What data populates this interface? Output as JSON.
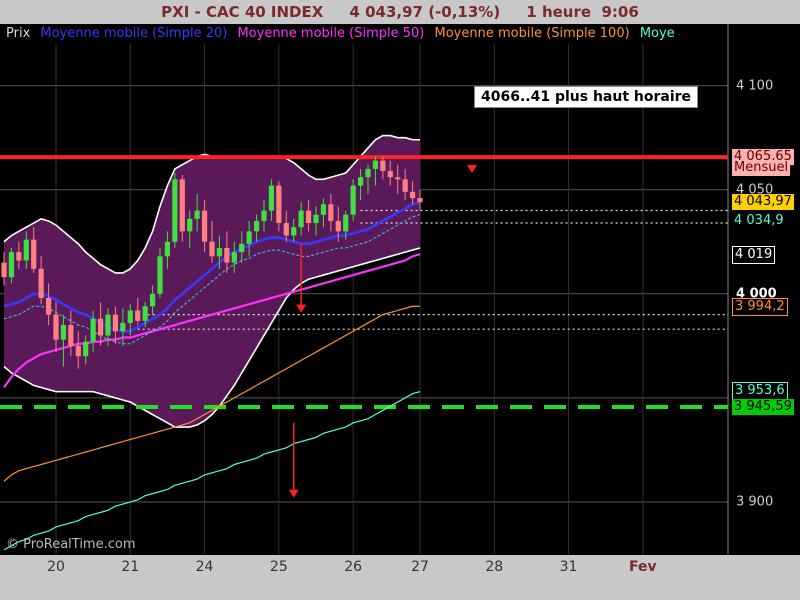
{
  "title": "PXI - CAC 40 INDEX     4 043,97 (-0,13%)     1 heure  9:06",
  "legend": [
    {
      "label": "Prix",
      "color": "#d8d8d8"
    },
    {
      "label": "Moyenne mobile (Simple 20)",
      "color": "#3838ff"
    },
    {
      "label": "Moyenne mobile (Simple 50)",
      "color": "#ff30ff"
    },
    {
      "label": "Moyenne mobile (Simple 100)",
      "color": "#ff9030"
    },
    {
      "label": "Moye",
      "color": "#50ffd8"
    }
  ],
  "annotation": "4066..41 plus haut  horaire",
  "copyright": "© ProRealTime.com",
  "yaxis": {
    "ticks": [
      {
        "value": 4100,
        "label": "4 100"
      },
      {
        "value": 4050,
        "label": "4 050"
      },
      {
        "value": 4000,
        "label": "4 000",
        "bold": true
      },
      {
        "value": 3950,
        "label": ""
      },
      {
        "value": 3900,
        "label": "3 900"
      }
    ]
  },
  "price_tags": [
    {
      "value": 4065.65,
      "label": "4 065,65",
      "bg": "#ffb0b0",
      "fg": "#600000"
    },
    {
      "value": 4060.5,
      "label": "Mensuel",
      "bg": "#ffb0b0",
      "fg": "#600000"
    },
    {
      "value": 4043.97,
      "label": "4 043,97",
      "bg": "#ffd000",
      "fg": "#000000"
    },
    {
      "value": 4034.9,
      "label": "4 034,9",
      "bg": "#000000",
      "fg": "#50ffd8"
    },
    {
      "value": 4019,
      "label": "4 019",
      "bg": "#000000",
      "fg": "#ffffff",
      "border": "#ffffff"
    },
    {
      "value": 3994.2,
      "label": "3 994,2",
      "bg": "#000000",
      "fg": "#ff9030",
      "border": "#ff9030"
    },
    {
      "value": 3953.6,
      "label": "3 953,6",
      "bg": "#000000",
      "fg": "#50ffd8",
      "border": "#50ffd8"
    },
    {
      "value": 3945.59,
      "label": "3 945,59",
      "bg": "#00cc00",
      "fg": "#000000"
    }
  ],
  "xaxis": {
    "ticks": [
      {
        "label": "20",
        "bar": 7
      },
      {
        "label": "21",
        "bar": 17
      },
      {
        "label": "24",
        "bar": 27
      },
      {
        "label": "25",
        "bar": 37
      },
      {
        "label": "26",
        "bar": 47
      },
      {
        "label": "27",
        "bar": 56
      },
      {
        "label": "28",
        "bar": 66
      },
      {
        "label": "31",
        "bar": 76
      },
      {
        "label": "Fev",
        "bar": 86,
        "bold": true
      }
    ]
  },
  "chart_data": {
    "type": "candlestick",
    "title": "PXI - CAC 40 INDEX",
    "ylim": [
      3875,
      4120
    ],
    "xrange": [
      0,
      98
    ],
    "resistance": {
      "value": 4065.65,
      "color": "#ff2020"
    },
    "support": {
      "value": 3945.59,
      "color": "#20e020"
    },
    "dotted_levels": [
      4040,
      4034,
      3990,
      3983
    ],
    "candles": [
      [
        4015,
        4020,
        4004,
        4008
      ],
      [
        4008,
        4022,
        4005,
        4020
      ],
      [
        4020,
        4025,
        4012,
        4016
      ],
      [
        4016,
        4030,
        4012,
        4026
      ],
      [
        4026,
        4032,
        4010,
        4012
      ],
      [
        4012,
        4018,
        3995,
        3998
      ],
      [
        3998,
        4005,
        3985,
        3990
      ],
      [
        3990,
        3996,
        3972,
        3978
      ],
      [
        3978,
        3990,
        3965,
        3985
      ],
      [
        3985,
        3992,
        3970,
        3975
      ],
      [
        3975,
        3982,
        3964,
        3970
      ],
      [
        3970,
        3980,
        3966,
        3977
      ],
      [
        3977,
        3992,
        3972,
        3988
      ],
      [
        3988,
        3996,
        3975,
        3980
      ],
      [
        3980,
        3993,
        3975,
        3990
      ],
      [
        3990,
        3994,
        3976,
        3982
      ],
      [
        3982,
        3993,
        3975,
        3986
      ],
      [
        3986,
        3995,
        3980,
        3992
      ],
      [
        3992,
        3998,
        3985,
        3987
      ],
      [
        3987,
        3996,
        3984,
        3994
      ],
      [
        3994,
        4004,
        3990,
        4000
      ],
      [
        4000,
        4022,
        3998,
        4018
      ],
      [
        4018,
        4030,
        4012,
        4025
      ],
      [
        4025,
        4058,
        4022,
        4055
      ],
      [
        4055,
        4057,
        4025,
        4030
      ],
      [
        4030,
        4040,
        4022,
        4036
      ],
      [
        4036,
        4048,
        4030,
        4040
      ],
      [
        4040,
        4045,
        4020,
        4025
      ],
      [
        4025,
        4035,
        4015,
        4018
      ],
      [
        4018,
        4028,
        4012,
        4022
      ],
      [
        4022,
        4030,
        4010,
        4015
      ],
      [
        4015,
        4025,
        4010,
        4020
      ],
      [
        4020,
        4030,
        4015,
        4024
      ],
      [
        4024,
        4035,
        4018,
        4030
      ],
      [
        4030,
        4038,
        4025,
        4035
      ],
      [
        4035,
        4045,
        4030,
        4040
      ],
      [
        4040,
        4055,
        4035,
        4052
      ],
      [
        4052,
        4054,
        4030,
        4034
      ],
      [
        4034,
        4040,
        4025,
        4028
      ],
      [
        4028,
        4036,
        4025,
        4032
      ],
      [
        4032,
        4044,
        4028,
        4040
      ],
      [
        4040,
        4045,
        4030,
        4034
      ],
      [
        4034,
        4042,
        4028,
        4038
      ],
      [
        4038,
        4046,
        4032,
        4043
      ],
      [
        4043,
        4048,
        4030,
        4035
      ],
      [
        4035,
        4042,
        4025,
        4030
      ],
      [
        4030,
        4040,
        4026,
        4038
      ],
      [
        4038,
        4055,
        4035,
        4052
      ],
      [
        4052,
        4060,
        4045,
        4056
      ],
      [
        4056,
        4062,
        4048,
        4060
      ],
      [
        4060,
        4066,
        4052,
        4064
      ],
      [
        4064,
        4066,
        4055,
        4059
      ],
      [
        4059,
        4064,
        4052,
        4056
      ],
      [
        4056,
        4062,
        4048,
        4055
      ],
      [
        4055,
        4060,
        4045,
        4049
      ],
      [
        4049,
        4054,
        4043,
        4046
      ],
      [
        4046,
        4050,
        4040,
        4044
      ]
    ],
    "ma20": [
      3994,
      3995,
      3996,
      3998,
      4000,
      4000,
      3999,
      3997,
      3995,
      3993,
      3991,
      3990,
      3988,
      3986,
      3984,
      3983,
      3982,
      3982,
      3984,
      3986,
      3988,
      3990,
      3993,
      3997,
      4000,
      4003,
      4006,
      4009,
      4012,
      4015,
      4018,
      4020,
      4022,
      4023,
      4025,
      4026,
      4027,
      4027,
      4026,
      4025,
      4024,
      4024,
      4025,
      4026,
      4027,
      4028,
      4028,
      4029,
      4030,
      4031,
      4033,
      4035,
      4037,
      4039,
      4041,
      4043,
      4044
    ],
    "ma50": [
      3955,
      3960,
      3964,
      3967,
      3969,
      3971,
      3972,
      3973,
      3974,
      3975,
      3976,
      3976,
      3977,
      3977,
      3978,
      3978,
      3979,
      3979,
      3980,
      3981,
      3982,
      3983,
      3984,
      3985,
      3986,
      3987,
      3988,
      3989,
      3990,
      3991,
      3992,
      3993,
      3994,
      3995,
      3996,
      3997,
      3998,
      3999,
      4000,
      4001,
      4002,
      4003,
      4004,
      4005,
      4006,
      4007,
      4008,
      4009,
      4010,
      4011,
      4012,
      4013,
      4014,
      4015,
      4016,
      4018,
      4019
    ],
    "ma100": [
      3910,
      3913,
      3915,
      3916,
      3917,
      3918,
      3919,
      3920,
      3921,
      3922,
      3923,
      3924,
      3925,
      3926,
      3927,
      3928,
      3929,
      3930,
      3931,
      3932,
      3933,
      3934,
      3935,
      3936,
      3937,
      3938,
      3940,
      3942,
      3944,
      3946,
      3948,
      3950,
      3952,
      3954,
      3956,
      3958,
      3960,
      3962,
      3964,
      3966,
      3968,
      3970,
      3972,
      3974,
      3976,
      3978,
      3980,
      3982,
      3984,
      3986,
      3988,
      3990,
      3991,
      3992,
      3993,
      3994,
      3994
    ],
    "ma200": [
      3877,
      3879,
      3881,
      3882,
      3884,
      3885,
      3886,
      3888,
      3889,
      3890,
      3891,
      3893,
      3894,
      3895,
      3896,
      3898,
      3899,
      3900,
      3901,
      3903,
      3904,
      3905,
      3906,
      3908,
      3909,
      3910,
      3911,
      3913,
      3914,
      3915,
      3916,
      3918,
      3919,
      3920,
      3921,
      3923,
      3924,
      3925,
      3926,
      3928,
      3929,
      3930,
      3931,
      3933,
      3934,
      3935,
      3936,
      3938,
      3939,
      3940,
      3942,
      3944,
      3946,
      3948,
      3950,
      3952,
      3953
    ],
    "band_upper": [
      4025,
      4028,
      4030,
      4032,
      4034,
      4036,
      4035,
      4033,
      4030,
      4027,
      4024,
      4020,
      4017,
      4014,
      4012,
      4010,
      4010,
      4012,
      4016,
      4022,
      4030,
      4042,
      4052,
      4060,
      4062,
      4064,
      4066,
      4067,
      4066,
      4066,
      4066,
      4066,
      4066,
      4066,
      4066,
      4066,
      4066,
      4066,
      4065,
      4063,
      4060,
      4057,
      4055,
      4055,
      4056,
      4057,
      4058,
      4062,
      4066,
      4070,
      4074,
      4076,
      4076,
      4075,
      4075,
      4074,
      4074
    ],
    "band_lower": [
      3965,
      3962,
      3960,
      3958,
      3956,
      3955,
      3954,
      3953,
      3953,
      3953,
      3953,
      3953,
      3953,
      3952,
      3951,
      3950,
      3949,
      3948,
      3946,
      3944,
      3942,
      3940,
      3938,
      3936,
      3936,
      3936,
      3937,
      3939,
      3942,
      3946,
      3951,
      3956,
      3962,
      3968,
      3974,
      3980,
      3986,
      3992,
      3998,
      4002,
      4005,
      4007,
      4008,
      4009,
      4010,
      4011,
      4012,
      4013,
      4014,
      4015,
      4016,
      4017,
      4018,
      4019,
      4020,
      4021,
      4022
    ],
    "arrows": [
      {
        "bar": 63,
        "from": 4062,
        "to": 4058
      },
      {
        "bar": 40,
        "from": 4024,
        "to": 3991
      },
      {
        "bar": 39,
        "from": 3938,
        "to": 3902
      }
    ]
  }
}
